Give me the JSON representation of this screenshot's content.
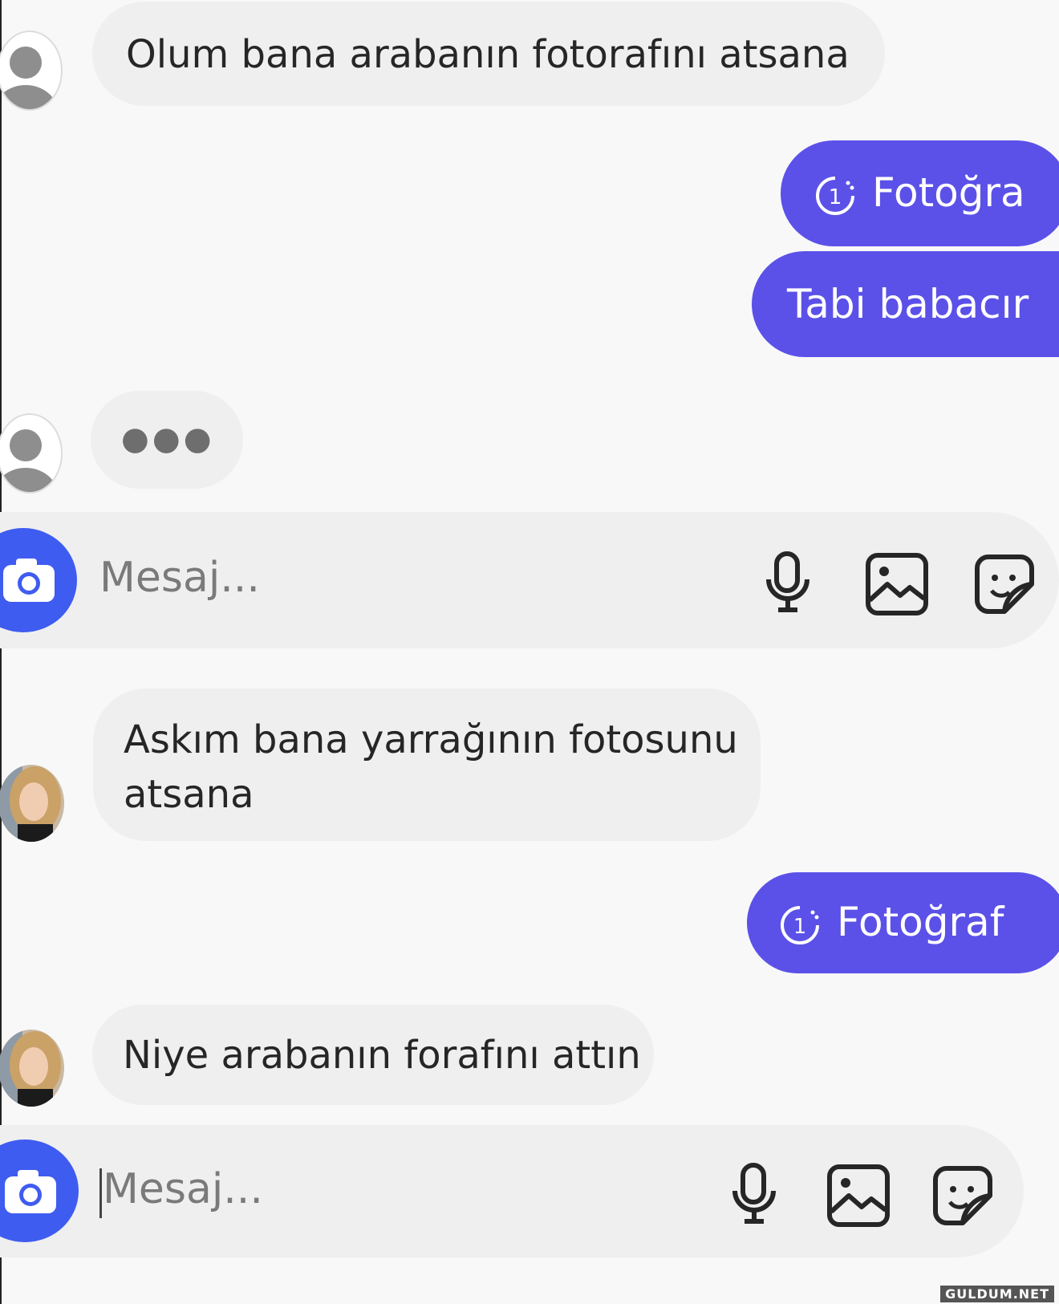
{
  "chat_top": {
    "messages": [
      {
        "from": "other",
        "text": "Olum bana arabanın fotorafını atsana"
      },
      {
        "from": "me",
        "type": "photo",
        "text": "Fotoğra"
      },
      {
        "from": "me",
        "text": "Tabi babacır"
      },
      {
        "from": "other",
        "type": "typing",
        "text": "●●●"
      }
    ],
    "composer": {
      "placeholder": "Mesaj..."
    }
  },
  "chat_bottom": {
    "messages": [
      {
        "from": "other",
        "text": "Askım bana yarrağının fotosunu atsana"
      },
      {
        "from": "me",
        "type": "photo",
        "text": "Fotoğraf"
      },
      {
        "from": "other",
        "text": "Niye arabanın forafını attın"
      }
    ],
    "composer": {
      "placeholder": "Mesaj..."
    }
  },
  "photo_badge_count": "1",
  "watermark": "GULDUM.NET",
  "colors": {
    "accent": "#5b51e8",
    "camera": "#3f5cf0",
    "bubble_in": "#efefef",
    "background": "#f8f8f8"
  },
  "icons": [
    "person-icon",
    "camera-icon",
    "microphone-icon",
    "gallery-icon",
    "sticker-icon",
    "view-once-icon"
  ]
}
